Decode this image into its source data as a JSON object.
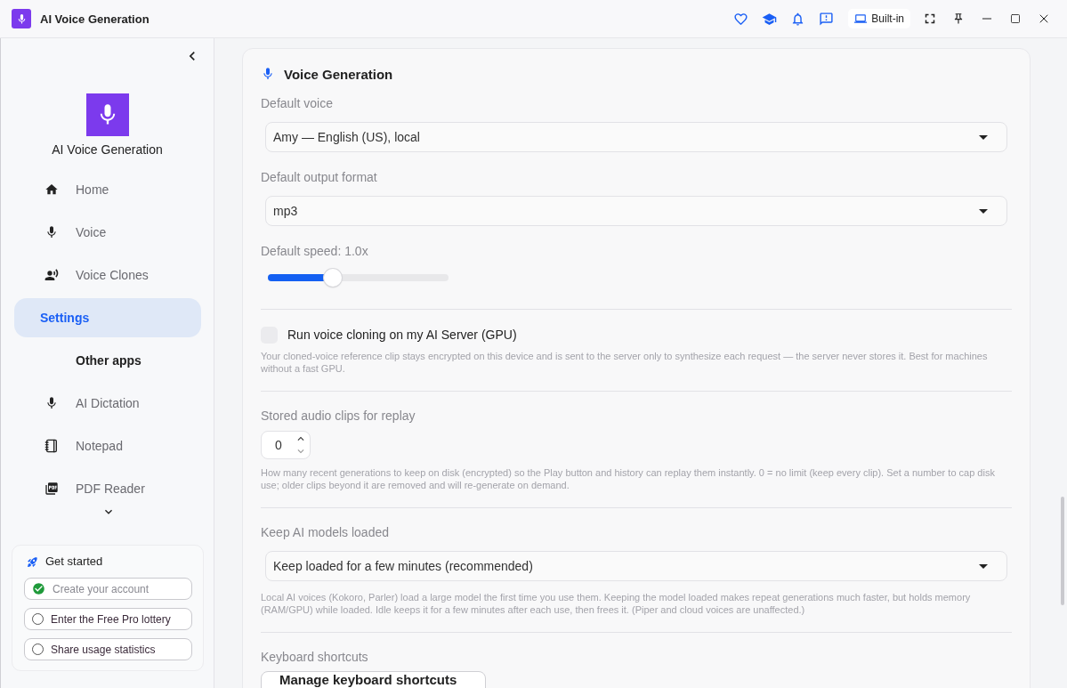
{
  "window": {
    "title": "AI Voice Generation",
    "chip": "Built-in"
  },
  "sidebar": {
    "app_name": "AI Voice Generation",
    "nav": [
      {
        "label": "Home",
        "selected": false
      },
      {
        "label": "Voice",
        "selected": false
      },
      {
        "label": "Voice Clones",
        "selected": false
      },
      {
        "label": "Settings",
        "selected": true
      }
    ],
    "other_apps": {
      "heading": "Other apps",
      "items": [
        {
          "label": "AI Dictation"
        },
        {
          "label": "Notepad"
        },
        {
          "label": "PDF Reader"
        }
      ]
    },
    "get_started": {
      "title": "Get started",
      "tasks": [
        {
          "label": "Create your account",
          "checked": true
        },
        {
          "label": "Enter the Free Pro lottery",
          "checked": false
        },
        {
          "label": "Share usage statistics",
          "checked": false
        }
      ]
    }
  },
  "section": {
    "title": "Voice Generation",
    "groups": [
      {
        "items": [
          {
            "kind": "select",
            "label": "Default voice",
            "value": "Amy — English (US), local"
          },
          {
            "kind": "select",
            "label": "Default output format",
            "value": "mp3"
          },
          {
            "kind": "slider",
            "label": "Default speed: 1.0x",
            "level": 0.36
          }
        ]
      },
      {
        "items": [
          {
            "kind": "checkbox",
            "label": "Run voice cloning on my AI Server (GPU)",
            "checked": false,
            "help": "Your cloned-voice reference clip stays encrypted on this device and is sent to the server only to synthesize each request — the server never stores it. Best for machines without a fast GPU."
          }
        ]
      },
      {
        "items": [
          {
            "kind": "number",
            "label": "Stored audio clips for replay",
            "value": "0",
            "help": "How many recent generations to keep on disk (encrypted) so the Play button and history can replay them instantly. 0 = no limit (keep every clip). Set a number to cap disk use; older clips beyond it are removed and will re-generate on demand."
          }
        ]
      },
      {
        "items": [
          {
            "kind": "select",
            "label": "Keep AI models loaded",
            "value": "Keep loaded for a few minutes (recommended)",
            "help": "Local AI voices (Kokoro, Parler) load a large model the first time you use them. Keeping the model loaded makes repeat generations much faster, but holds memory (RAM/GPU) while loaded. Idle keeps it for a few minutes after each use, then frees it. (Piper and cloud voices are unaffected.)"
          }
        ]
      },
      {
        "items": [
          {
            "kind": "button",
            "label": "Keyboard shortcuts",
            "button": "Manage keyboard shortcuts"
          }
        ]
      }
    ]
  }
}
